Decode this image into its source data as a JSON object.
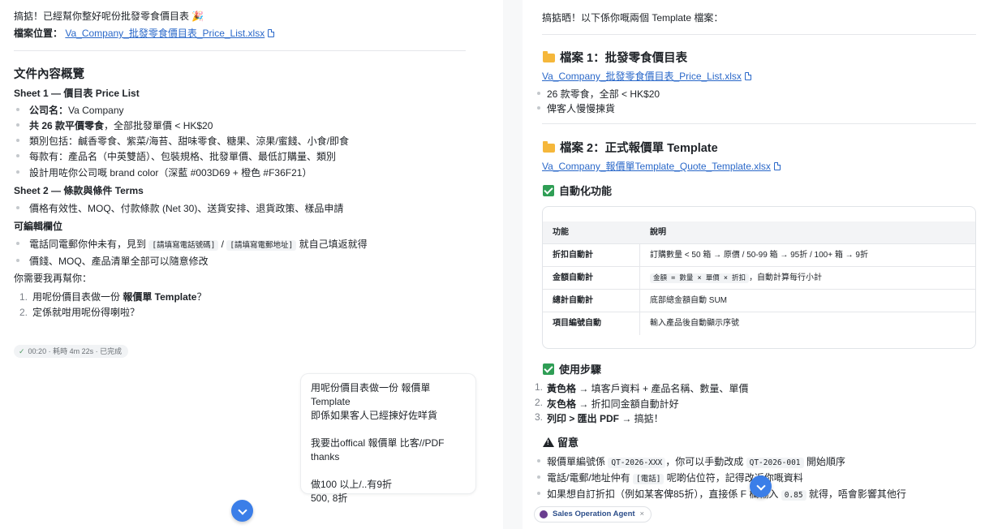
{
  "left": {
    "intro": "搞掂！已經幫你整好呢份批發零食價目表 🎉",
    "file_location_label": "檔案位置：",
    "file_link": "Va_Company_批發零食價目表_Price_List.xlsx",
    "overview_title": "文件內容概覽",
    "sheet1_title": "Sheet 1 — 價目表 Price List",
    "sheet1_items": [
      {
        "bold": "公司名：",
        "text": "Va Company"
      },
      {
        "bold": "共 26 款平價零食",
        "text": "，全部批發單價 < HK$20"
      },
      {
        "bold": "",
        "text": "類別包括：鹹香零食、紫菜/海苔、甜味零食、糖果、涼果/蜜餞、小食/即食"
      },
      {
        "bold": "",
        "text": "每款有：產品名（中英雙語）、包裝規格、批發單價、最低訂購量、類別"
      },
      {
        "bold": "",
        "text": "設計用咗你公司嘅 brand color（深藍 #003D69 + 橙色 #F36F21）"
      }
    ],
    "sheet2_title": "Sheet 2 — 條款與條件 Terms",
    "sheet2_items": [
      "價格有效性、MOQ、付款條款 (Net 30)、送貨安排、退貨政策、樣品申請"
    ],
    "editable_title": "可編輯欄位",
    "editable_item1_pre": "電話同電郵你仲未有，見到",
    "editable_item1_code1": "[請填寫電話號碼]",
    "editable_item1_mid": " / ",
    "editable_item1_code2": "[請填寫電郵地址]",
    "editable_item1_post": " 就自己填返就得",
    "editable_item2": "價錢、MOQ、產品清單全部可以隨意修改",
    "next_question": "你需要我再幫你：",
    "options": [
      {
        "num": "1.",
        "pre": "用呢份價目表做一份 ",
        "bold": "報價單 Template",
        "post": "？"
      },
      {
        "num": "2.",
        "pre": "定係就咁用呢份得喇啦？",
        "bold": "",
        "post": ""
      }
    ],
    "status": "00:20 · 耗時 4m 22s · 已完成"
  },
  "user_bubble": {
    "line1": "用呢份價目表做一份 報價單 Template",
    "line2": "即係如果客人已經揀好佐咩貨",
    "line3": "我要出offical 報價單 比客//PDF thanks",
    "line4": "做100 以上/..有9折",
    "line5": "500, 8折"
  },
  "right": {
    "intro": "搞掂晒！以下係你嘅兩個 Template 檔案：",
    "file1_title": "檔案 1：批發零食價目表",
    "file1_link": "Va_Company_批發零食價目表_Price_List.xlsx",
    "file1_items": [
      "26 款零食，全部 < HK$20",
      "俾客人慢慢揀貨"
    ],
    "file2_title": "檔案 2：正式報價單 Template",
    "file2_link": "Va_Company_報價單Template_Quote_Template.xlsx",
    "auto_title": "自動化功能",
    "table_headers": [
      "功能",
      "說明"
    ],
    "table_rows": [
      {
        "feature": "折扣自動計",
        "desc": "訂購數量 < 50 箱 → 原價 / 50-99 箱 → 95折 / 100+ 箱 → 9折"
      },
      {
        "feature": "金額自動計",
        "desc_code": "金額 = 數量 × 單價 × 折扣",
        "desc": "，自動計算每行小計"
      },
      {
        "feature": "總計自動計",
        "desc": "底部總金額自動 SUM"
      },
      {
        "feature": "項目編號自動",
        "desc": "輸入產品後自動顯示序號"
      }
    ],
    "steps_title": "使用步驟",
    "steps": [
      {
        "num": "1.",
        "bold": "黃色格",
        "text": " → 填客戶資料 + 產品名稱、數量、單價"
      },
      {
        "num": "2.",
        "bold": "灰色格",
        "text": " → 折扣同金額自動計好"
      },
      {
        "num": "3.",
        "bold": "列印 > 匯出 PDF",
        "text": " → 搞掂！"
      }
    ],
    "notes_title": "留意",
    "notes": [
      {
        "pre": "報價單編號係 ",
        "code1": "QT-2026-XXX",
        "mid": "，你可以手動改成 ",
        "code2": "QT-2026-001",
        "post": " 開始順序"
      },
      {
        "pre": "電話/電郵/地址仲有 ",
        "code1": "[電話]",
        "mid": " 呢啲佔位符，記得改返你嘅資料",
        "code2": "",
        "post": ""
      },
      {
        "pre": "如果想自訂折扣（例如某客俾85折），直接係 F 欄輸入 ",
        "code1": "0.85",
        "mid": " 就得，唔會影響其他行",
        "code2": "",
        "post": ""
      }
    ],
    "agent_chip": "Sales Operation Agent",
    "agent_chip_close": "×"
  }
}
